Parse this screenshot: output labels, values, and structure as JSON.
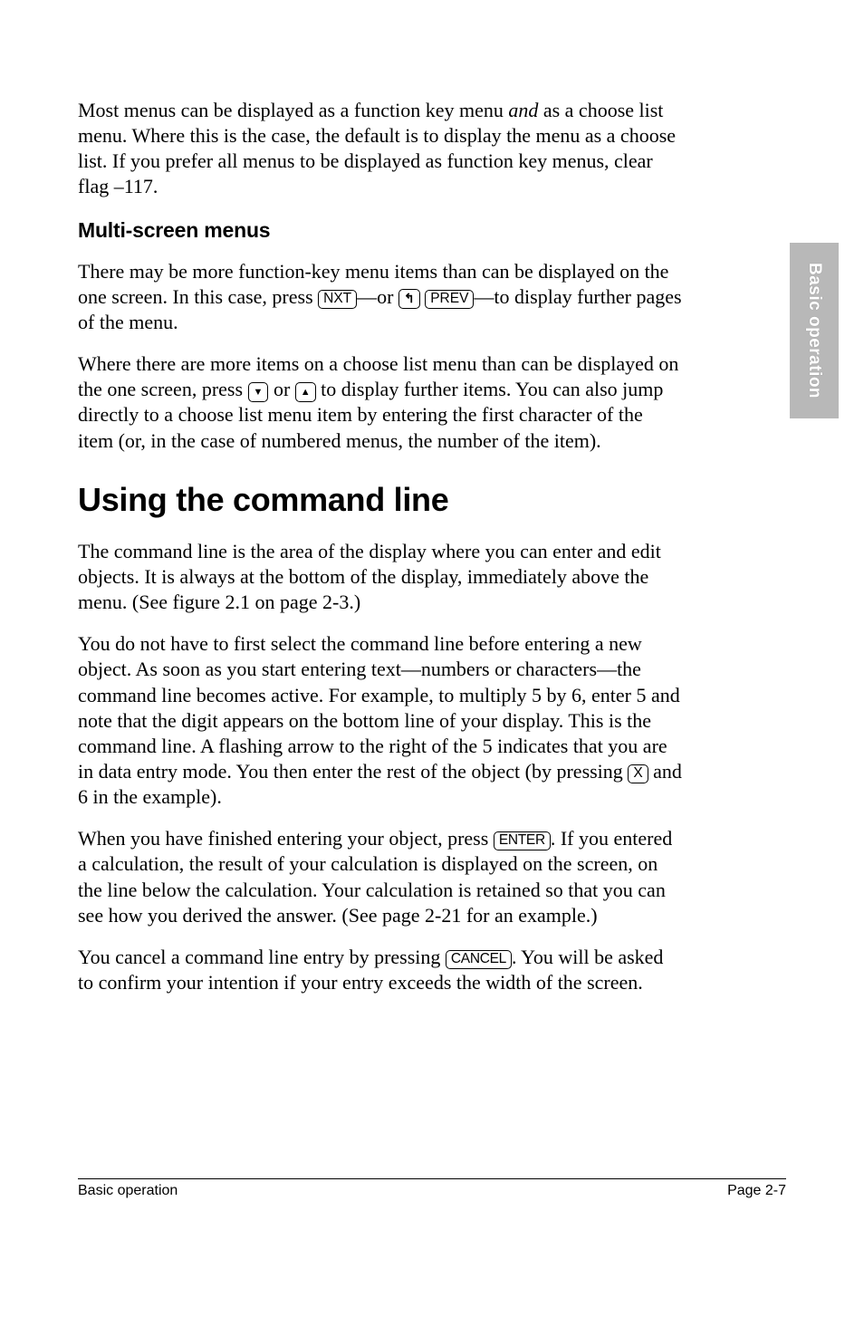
{
  "sidebar": {
    "label": "Basic operation"
  },
  "para1_pre": "Most menus can be displayed as a function key menu ",
  "para1_em": "and",
  "para1_post": " as a choose list menu. Where this is the case, the default is to display the menu as a choose list. If you prefer all menus to be displayed as function key menus, clear flag –117.",
  "subhead": "Multi-screen menus",
  "para2_a": "There may be more function-key menu items than can be displayed on the one screen. In this case, press ",
  "key_nxt": "NXT",
  "para2_b": "—or ",
  "key_shift": "↰",
  "key_prev": "PREV",
  "para2_c": "—to display further pages of the menu.",
  "para3_a": "Where there are more items on a choose list menu than can be displayed on the one screen, press ",
  "para3_b": " or ",
  "para3_c": " to display further items. You can also jump directly to a choose list menu item by entering the first character of the item (or, in the case of numbered menus, the number of the item).",
  "section": "Using the command line",
  "para4": "The command line is the area of the display where you can enter and edit objects. It is always at the bottom of the display, immediately above the menu. (See figure 2.1 on page 2-3.)",
  "para5_a": "You do not have to first select the command line before entering a new object. As soon as you start entering text—numbers or characters—the command line becomes active. For example, to multiply 5 by 6, enter 5 and note that the digit appears on the bottom line of your display. This is the command line. A flashing arrow to the right of the 5 indicates that you are in data entry mode. You then enter the rest of the object (by pressing ",
  "key_x": "X",
  "para5_b": " and 6 in the example).",
  "para6_a": "When you have finished entering your object, press ",
  "key_enter": "ENTER",
  "para6_b": ". If you entered a calculation, the result of your calculation is displayed on the screen, on the line below the calculation. Your calculation is retained so that you can see how you derived the answer. (See page 2-21 for an example.)",
  "para7_a": "You cancel a command line entry by pressing ",
  "key_cancel": "CANCEL",
  "para7_b": ". You will be asked to confirm your intention if your entry exceeds the width of the screen.",
  "footer": {
    "left": "Basic operation",
    "right": "Page 2-7"
  }
}
